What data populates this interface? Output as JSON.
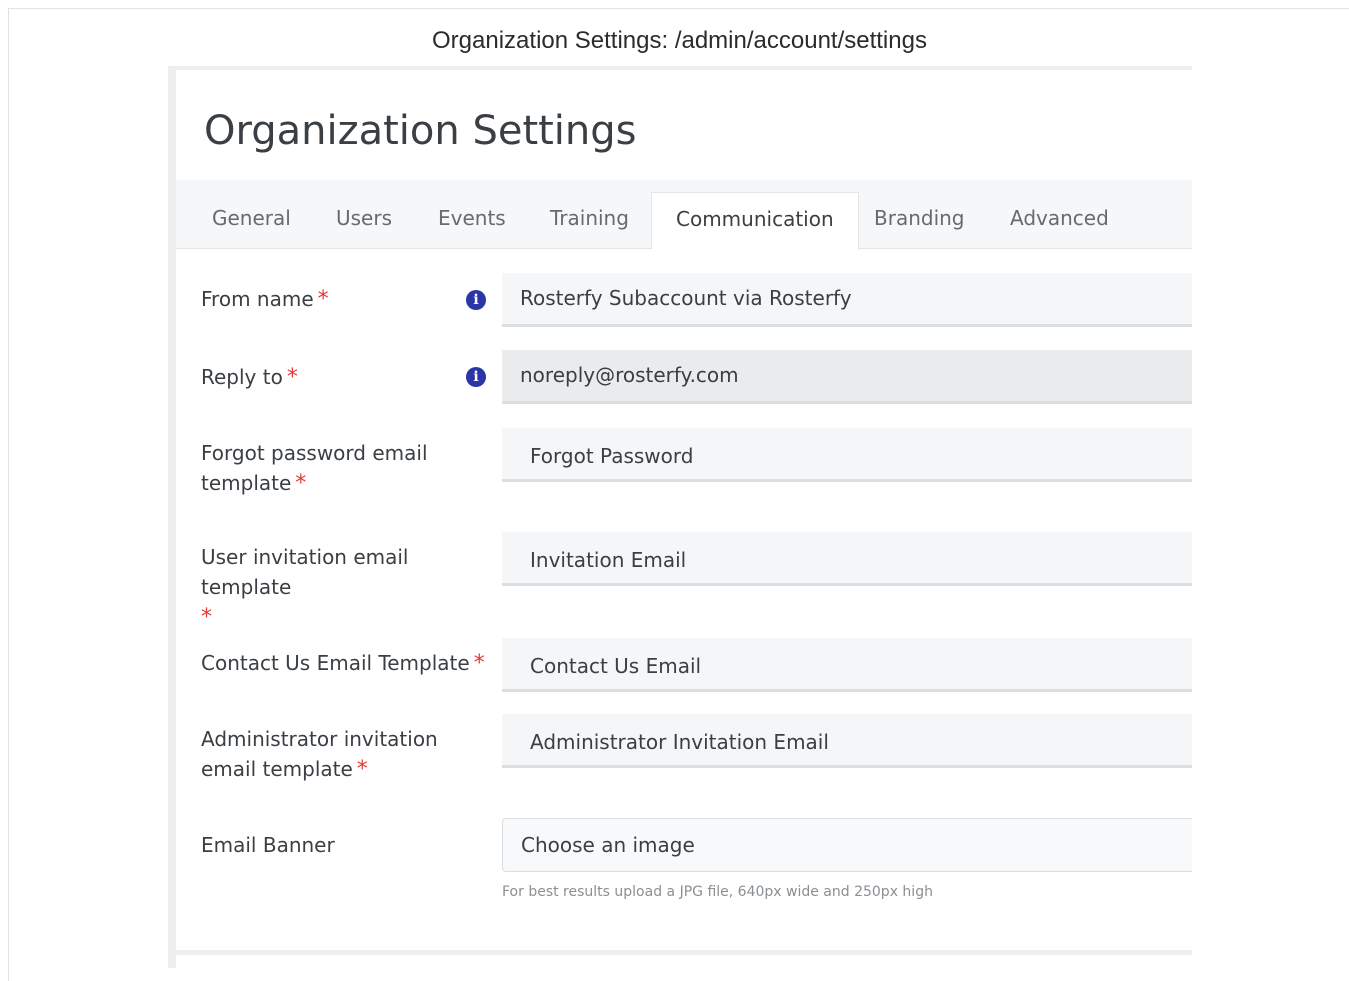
{
  "caption": "Organization Settings: /admin/account/settings",
  "page_title": "Organization Settings",
  "tabs": [
    {
      "label": "General"
    },
    {
      "label": "Users"
    },
    {
      "label": "Events"
    },
    {
      "label": "Training"
    },
    {
      "label": "Communication"
    },
    {
      "label": "Branding"
    },
    {
      "label": "Advanced"
    }
  ],
  "active_tab": "Communication",
  "form": {
    "from_name": {
      "label": "From name",
      "required_mark": "*",
      "info_icon": "info-icon",
      "value": "Rosterfy Subaccount via Rosterfy"
    },
    "reply_to": {
      "label": "Reply to",
      "required_mark": "*",
      "info_icon": "info-icon",
      "value": "noreply@rosterfy.com"
    },
    "forgot_password": {
      "label": "Forgot password email template",
      "required_mark": "*",
      "value": "Forgot Password"
    },
    "user_invitation": {
      "label": "User invitation email template",
      "required_mark": "*",
      "value": "Invitation Email"
    },
    "contact_us": {
      "label": "Contact Us Email Template",
      "required_mark": "*",
      "value": "Contact Us Email"
    },
    "admin_invitation": {
      "label": "Administrator invitation email template",
      "required_mark": "*",
      "value": "Administrator Invitation Email"
    },
    "email_banner": {
      "label": "Email Banner",
      "placeholder": "Choose an image",
      "hint": "For best results upload a JPG file, 640px wide and 250px high"
    }
  },
  "colors": {
    "required": "#e53935",
    "info_icon": "#2a36a8",
    "field_bg": "#f5f6f7",
    "disabled_bg": "#e9ebed"
  }
}
